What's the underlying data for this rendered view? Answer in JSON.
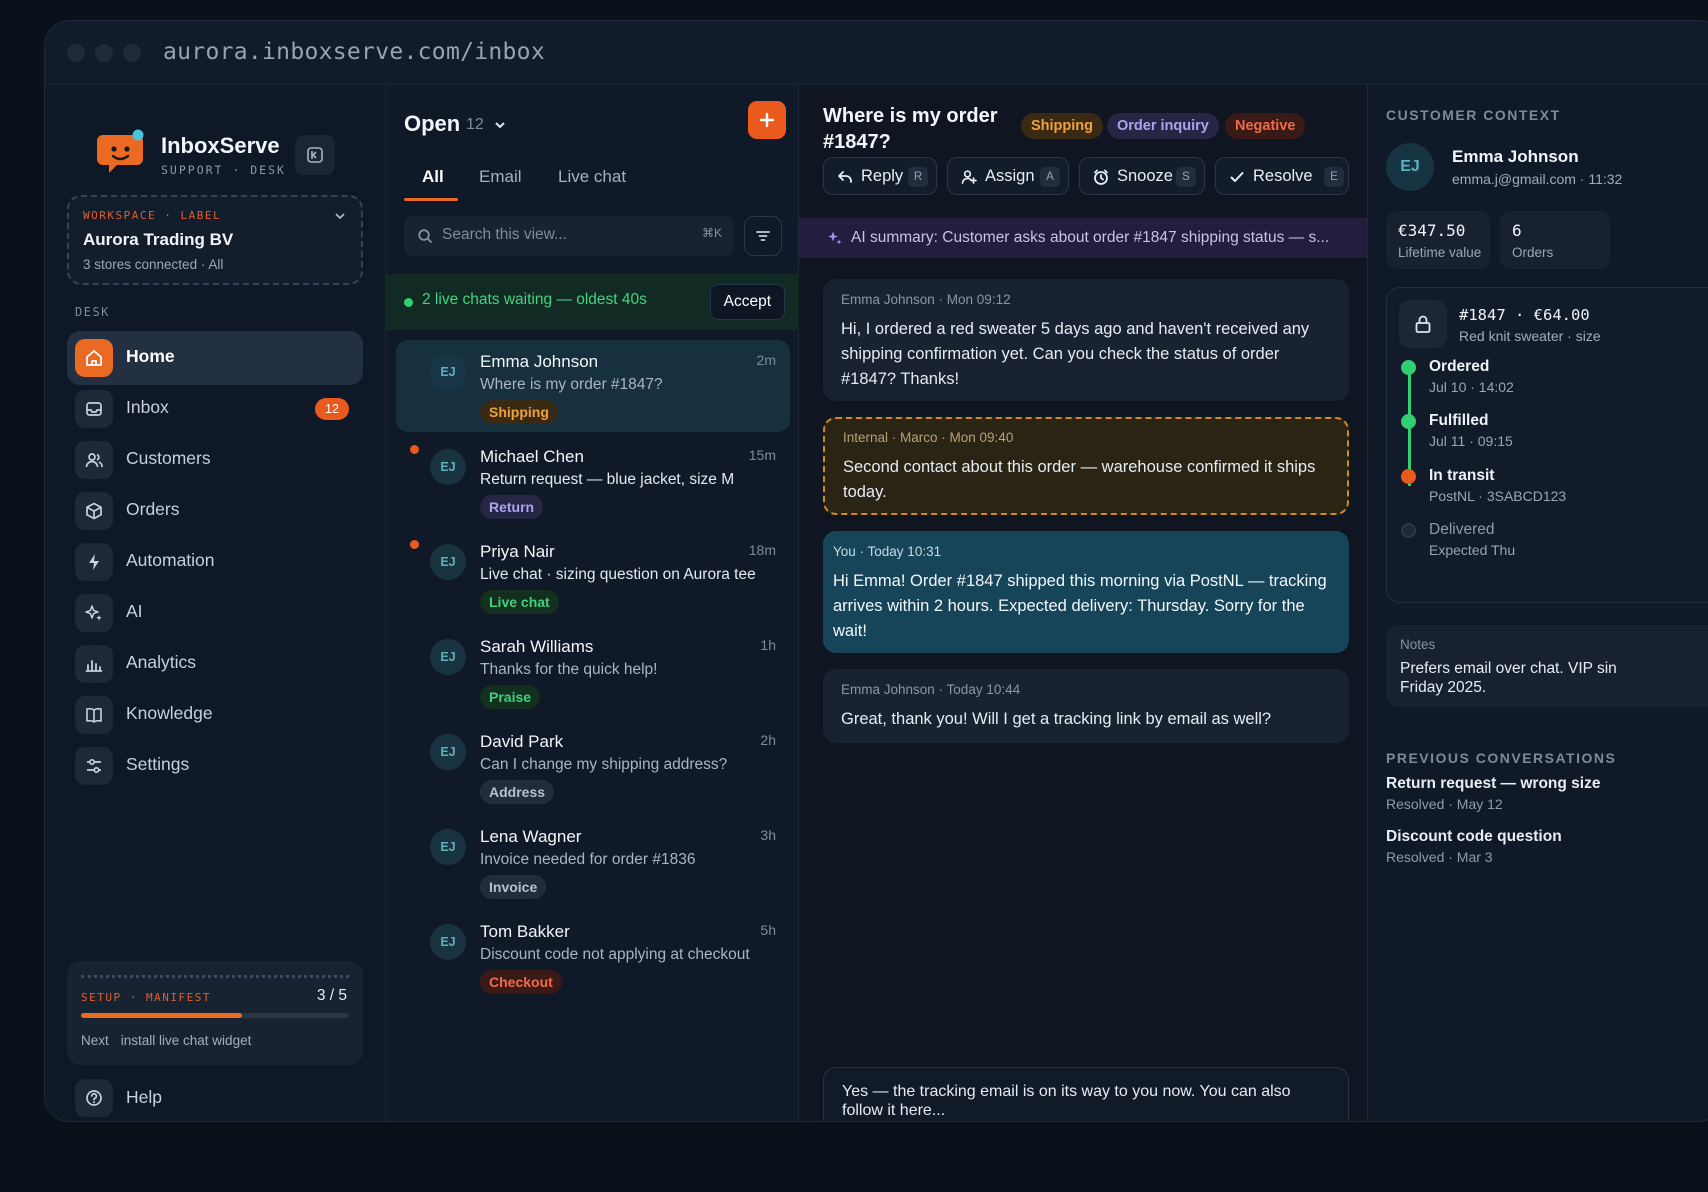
{
  "browser": {
    "url": "aurora.inboxserve.com/inbox"
  },
  "brand": {
    "name": "InboxServe",
    "subtitle": "SUPPORT · DESK"
  },
  "workspace": {
    "label": "WORKSPACE · LABEL",
    "name": "Aurora Trading BV",
    "meta": "3 stores connected · All"
  },
  "sidebar": {
    "section_label": "DESK",
    "items": [
      {
        "label": "Home",
        "active": true,
        "icon": "home-icon"
      },
      {
        "label": "Inbox",
        "badge": "12",
        "icon": "inbox-icon"
      },
      {
        "label": "Customers",
        "icon": "users-icon"
      },
      {
        "label": "Orders",
        "icon": "box-icon"
      },
      {
        "label": "Automation",
        "icon": "bolt-icon"
      },
      {
        "label": "AI",
        "icon": "sparkle-icon"
      },
      {
        "label": "Analytics",
        "icon": "bar-chart-icon"
      },
      {
        "label": "Knowledge",
        "icon": "book-icon"
      },
      {
        "label": "Settings",
        "icon": "sliders-icon"
      }
    ],
    "setup": {
      "label": "SETUP · MANIFEST",
      "count": "3 / 5",
      "progress": 0.6,
      "next_label": "Next",
      "next_value": "install live chat widget"
    },
    "help": {
      "label": "Help"
    }
  },
  "list": {
    "title": "Open",
    "count": "12",
    "tabs": [
      "All",
      "Email",
      "Live chat"
    ],
    "search_placeholder": "Search this view...",
    "search_shortcut": "⌘K",
    "live_banner": {
      "text": "2 live chats waiting — oldest 40s",
      "action": "Accept"
    },
    "conversations": [
      {
        "initials": "EJ",
        "name": "Emma Johnson",
        "time": "2m",
        "preview": "Where is my order #1847?",
        "tag": "Shipping",
        "tag_color": "#f0a13a",
        "tag_bg": "#3a2a14",
        "active": true,
        "unread": false
      },
      {
        "initials": "EJ",
        "name": "Michael Chen",
        "time": "15m",
        "preview": "Return request — blue jacket, size M",
        "tag": "Return",
        "tag_color": "#a9a6f0",
        "tag_bg": "#262645",
        "unread": true
      },
      {
        "initials": "EJ",
        "name": "Priya Nair",
        "time": "18m",
        "preview": "Live chat · sizing question on Aurora tee",
        "tag": "Live chat",
        "tag_color": "#3ed27c",
        "tag_bg": "#13301f",
        "unread": true
      },
      {
        "initials": "EJ",
        "name": "Sarah Williams",
        "time": "1h",
        "preview": "Thanks for the quick help!",
        "tag": "Praise",
        "tag_color": "#3ed27c",
        "tag_bg": "#13301f",
        "unread": false
      },
      {
        "initials": "EJ",
        "name": "David Park",
        "time": "2h",
        "preview": "Can I change my shipping address?",
        "tag": "Address",
        "tag_color": "#b7c0cd",
        "tag_bg": "#222d3b",
        "unread": false
      },
      {
        "initials": "EJ",
        "name": "Lena Wagner",
        "time": "3h",
        "preview": "Invoice needed for order #1836",
        "tag": "Invoice",
        "tag_color": "#b7c0cd",
        "tag_bg": "#222d3b",
        "unread": false
      },
      {
        "initials": "EJ",
        "name": "Tom Bakker",
        "time": "5h",
        "preview": "Discount code not applying at checkout",
        "tag": "Checkout",
        "tag_color": "#f26a4b",
        "tag_bg": "#3a1a16",
        "unread": false
      }
    ]
  },
  "detail": {
    "subject": "Where is my order #1847?",
    "pills": [
      {
        "label": "Shipping",
        "color": "#f0a13a",
        "bg": "#3a2a14"
      },
      {
        "label": "Order inquiry",
        "color": "#a9a6f0",
        "bg": "#262645"
      },
      {
        "label": "Negative",
        "color": "#f26a4b",
        "bg": "#3a1a16"
      }
    ],
    "actions": [
      {
        "label": "Reply",
        "key": "R",
        "icon": "reply-icon"
      },
      {
        "label": "Assign",
        "key": "A",
        "icon": "assign-icon"
      },
      {
        "label": "Snooze",
        "key": "S",
        "icon": "snooze-icon"
      },
      {
        "label": "Resolve",
        "key": "E",
        "icon": "check-icon"
      }
    ],
    "ai_summary": "AI summary: Customer asks about order #1847 shipping status — s...",
    "messages": [
      {
        "type": "customer",
        "meta": "Emma Johnson · Mon 09:12",
        "body": "Hi, I ordered a red sweater 5 days ago and haven't received any shipping confirmation yet. Can you check the status of order #1847? Thanks!"
      },
      {
        "type": "internal",
        "meta": "Internal · Marco · Mon 09:40",
        "body": "Second contact about this order — warehouse confirmed it ships today."
      },
      {
        "type": "you",
        "meta": "You · Today 10:31",
        "body": "Hi Emma! Order #1847 shipped this morning via PostNL — tracking arrives within 2 hours. Expected delivery: Thursday. Sorry for the wait!"
      },
      {
        "type": "customer",
        "meta": "Emma Johnson · Today 10:44",
        "body": "Great, thank you! Will I get a tracking link by email as well?"
      }
    ],
    "composer_draft": "Yes — the tracking email is on its way to you now. You can also follow it here..."
  },
  "context": {
    "section_label": "CUSTOMER CONTEXT",
    "initials": "EJ",
    "name": "Emma Johnson",
    "email": "emma.j@gmail.com · 11:32",
    "stats": [
      {
        "value": "€347.50",
        "label": "Lifetime value"
      },
      {
        "value": "6",
        "label": "Orders"
      }
    ],
    "order": {
      "id": "#1847 · €64.00",
      "desc": "Red knit sweater · size",
      "timeline": [
        {
          "title": "Ordered",
          "sub": "Jul 10 · 14:02",
          "state": "done"
        },
        {
          "title": "Fulfilled",
          "sub": "Jul 11 · 09:15",
          "state": "done"
        },
        {
          "title": "In transit",
          "sub": "PostNL · 3SABCD123",
          "state": "current"
        },
        {
          "title": "Delivered",
          "sub": "Expected Thu",
          "state": "pending"
        }
      ]
    },
    "notes": {
      "label": "Notes",
      "text": "Prefers email over chat. VIP sin",
      "text2": "Friday 2025."
    },
    "previous_label": "PREVIOUS CONVERSATIONS",
    "previous": [
      {
        "title": "Return request — wrong size",
        "sub": "Resolved · May 12"
      },
      {
        "title": "Discount code question",
        "sub": "Resolved · Mar 3"
      }
    ]
  }
}
